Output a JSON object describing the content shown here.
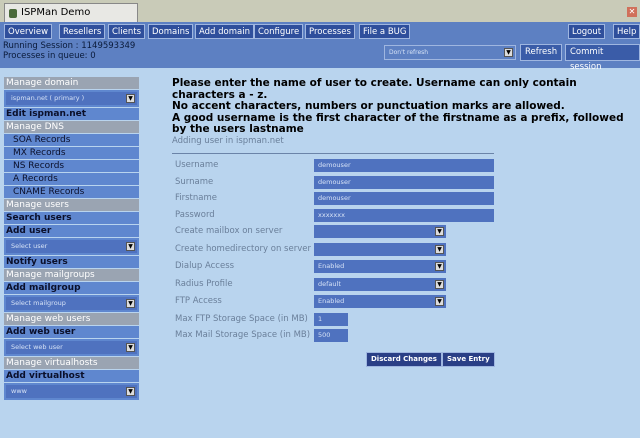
{
  "window": {
    "title": "ISPMan Demo"
  },
  "nav": [
    "Overview",
    "Resellers",
    "Clients",
    "Domains",
    "Add domain",
    "Configure",
    "Processes",
    "File a BUG"
  ],
  "nav_right": {
    "logout": "Logout",
    "help": "Help"
  },
  "session": {
    "running": "Running Session : 1149593349",
    "queue": "Processes in queue: 0",
    "refresh_select": "Don't refresh",
    "refresh": "Refresh",
    "commit": "Commit session"
  },
  "sidebar": {
    "manage_domain": "Manage domain",
    "domain_select": "ispman.net ( primary )",
    "edit": "Edit ispman.net",
    "manage_dns": "Manage DNS",
    "dns": [
      "SOA Records",
      "MX Records",
      "NS Records",
      "A Records",
      "CNAME Records"
    ],
    "manage_users": "Manage users",
    "search_users": "Search users",
    "add_user": "Add user",
    "user_select": "Select user",
    "notify": "Notify users",
    "manage_mailgroups": "Manage mailgroups",
    "add_mailgroup": "Add mailgroup",
    "mailgroup_select": "Select mailgroup",
    "manage_web": "Manage web users",
    "add_web": "Add web user",
    "web_select": "Select web user",
    "manage_vhosts": "Manage virtualhosts",
    "add_vhost": "Add virtualhost",
    "vhost_select": "www"
  },
  "intro": [
    "Please enter the name of user to create. Username can only contain characters a - z.",
    "No accent characters, numbers or punctuation marks are allowed.",
    "A good username is the first character of the firstname as a prefix, followed by the users lastname"
  ],
  "form": {
    "title": "Adding user in ispman.net",
    "fields": [
      {
        "label": "Username",
        "value": "demouser"
      },
      {
        "label": "Surname",
        "value": "demouser"
      },
      {
        "label": "Firstname",
        "value": "demouser"
      },
      {
        "label": "Password",
        "value": "xxxxxxx"
      },
      {
        "label": "Create mailbox on server",
        "value": ""
      },
      {
        "label": "Create homedirectory on server",
        "value": ""
      },
      {
        "label": "Dialup Access",
        "value": "Enabled"
      },
      {
        "label": "Radius Profile",
        "value": "default"
      },
      {
        "label": "FTP Access",
        "value": "Enabled"
      },
      {
        "label": "Max FTP Storage Space (in MB)",
        "value": "1"
      },
      {
        "label": "Max Mail Storage Space (in MB)",
        "value": "500"
      }
    ],
    "discard": "Discard Changes",
    "save": "Save Entry"
  }
}
